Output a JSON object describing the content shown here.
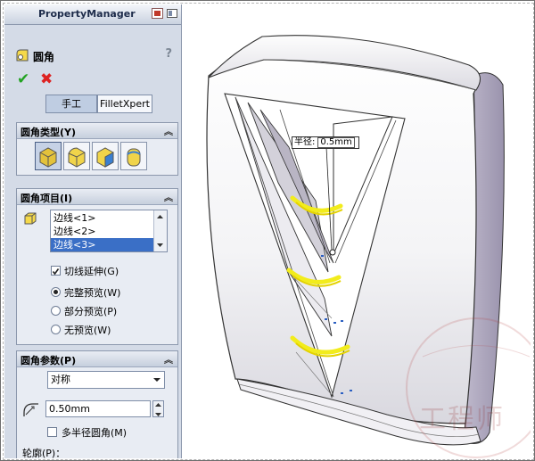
{
  "panel": {
    "title": "PropertyManager",
    "feature_name": "圆角",
    "help_label": "?",
    "ok_label": "✔",
    "cancel_label": "✖",
    "tabs": [
      {
        "label": "手工",
        "selected": true
      },
      {
        "label": "FilletXpert",
        "selected": false
      }
    ]
  },
  "fillet_type": {
    "title": "圆角类型(Y)",
    "options": [
      "constant-radius",
      "variable-radius",
      "face-fillet",
      "full-round"
    ],
    "selected_index": 0
  },
  "fillet_items": {
    "title": "圆角项目(I)",
    "edges": [
      "边线<1>",
      "边线<2>",
      "边线<3>"
    ],
    "selected_edge_index": 2,
    "tangent_propagation": {
      "label": "切线延伸(G)",
      "checked": true
    },
    "preview_options": [
      {
        "label": "完整预览(W)",
        "selected": true
      },
      {
        "label": "部分预览(P)",
        "selected": false
      },
      {
        "label": "无预览(W)",
        "selected": false
      }
    ]
  },
  "fillet_params": {
    "title": "圆角参数(P)",
    "method": "对称",
    "radius": "0.50mm",
    "multi_radius": {
      "label": "多半径圆角(M)",
      "checked": false
    },
    "profile_label": "轮廓(P)："
  },
  "viewport": {
    "dimension_label": "半径:",
    "dimension_value": "0.5mm",
    "watermark_text": "工程师",
    "colors": {
      "highlight": "#f2ec1c",
      "model": "#ffffff",
      "shadow": "#c9c4d4"
    }
  }
}
